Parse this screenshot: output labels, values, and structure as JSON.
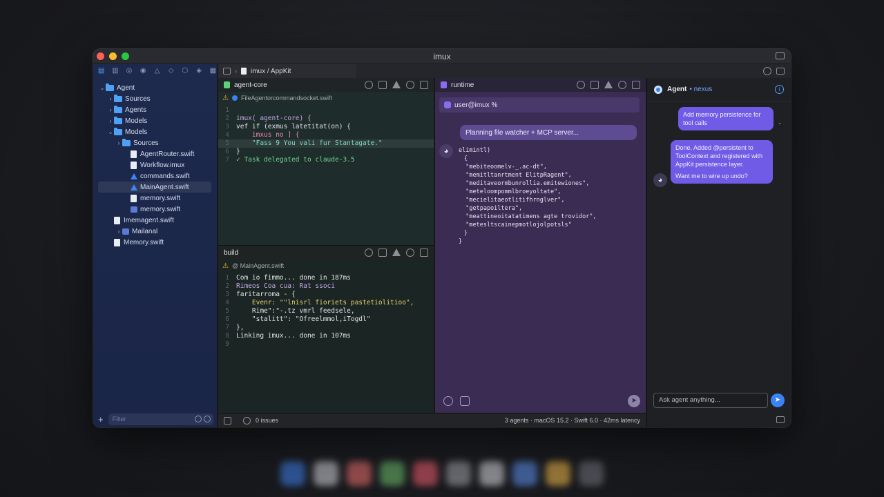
{
  "window": {
    "title": "imux"
  },
  "sidebar": {
    "toolbar_icons": [
      "navigator-icon",
      "source-control-icon",
      "symbol-icon",
      "find-icon",
      "issue-icon",
      "test-icon",
      "debug-icon",
      "breakpoint-icon",
      "report-icon"
    ],
    "tree": [
      {
        "label": "Agent",
        "type": "folder",
        "depth": 0,
        "expanded": true
      },
      {
        "label": "Sources",
        "type": "folder",
        "depth": 1,
        "expanded": false
      },
      {
        "label": "Agents",
        "type": "folder",
        "depth": 1,
        "expanded": false
      },
      {
        "label": "Models",
        "type": "folder",
        "depth": 1,
        "expanded": false
      },
      {
        "label": "Models",
        "type": "folder",
        "depth": 1,
        "expanded": true
      },
      {
        "label": "Sources",
        "type": "folder",
        "depth": 2,
        "expanded": false
      },
      {
        "label": "AgentRouter.swift",
        "type": "file",
        "depth": 3
      },
      {
        "label": "Workflow.imux",
        "type": "file",
        "depth": 3
      },
      {
        "label": "commands.swift",
        "type": "swift",
        "depth": 3
      },
      {
        "label": "MainAgent.swift",
        "type": "swift",
        "depth": 3,
        "selected": true
      },
      {
        "label": "memory.swift",
        "type": "file",
        "depth": 3
      },
      {
        "label": "memory.swift",
        "type": "bundle",
        "depth": 3
      },
      {
        "label": "Imemagent.swift",
        "type": "file",
        "depth": 1
      },
      {
        "label": "Mailanal",
        "type": "bundle",
        "depth": 2,
        "collapsed_chevron": true
      },
      {
        "label": "Memory.swift",
        "type": "file",
        "depth": 1
      }
    ],
    "filter_placeholder": "Filter"
  },
  "path_bar": {
    "crumb": "imux / AppKit"
  },
  "agent_core": {
    "title": "agent-core",
    "warning": "FileAgentorcommandsocket.swift",
    "lines": [
      {
        "n": "1",
        "text": "",
        "color": "#8a8e96"
      },
      {
        "n": "2",
        "text": "imux( agent-core) {",
        "color": "#c3a8e8"
      },
      {
        "n": "3",
        "text": "vef if (exmus latetitat(on) {",
        "color": "#e4e4e8"
      },
      {
        "n": "4",
        "text": "    imxus no ] {",
        "color": "#f08aa8"
      },
      {
        "n": "5",
        "text": "    \"Fass 9 You vali fur Stantagate.\"",
        "color": "#7ed8c0"
      },
      {
        "n": "6",
        "text": "}",
        "color": "#e4e4e8"
      },
      {
        "n": "7",
        "text": "✓ Task delegated to claude-3.5",
        "color": "#6fd88e"
      }
    ]
  },
  "build": {
    "title": "build",
    "warning": "@ MainAgent.swift",
    "lines": [
      {
        "n": "1",
        "text": "Com io fimmo... done in 187ms",
        "color": "#e4e4e8"
      },
      {
        "n": "2",
        "text": "Rimeos Coa cua: Rat ssoci",
        "color": "#c3a8e8"
      },
      {
        "n": "3",
        "text": "faritarroma - {",
        "color": "#e4e4e8"
      },
      {
        "n": "4",
        "text": "    Evenr: \"\"lnisrl fioriets pastetiolitioo\",",
        "color": "#e6d070"
      },
      {
        "n": "5",
        "text": "    Rime\":\"-.tz vmrl feedsele,",
        "color": "#e4e4e8"
      },
      {
        "n": "6",
        "text": "    \"stalitt\": \"Ofreelmmol,iTogdl\"",
        "color": "#e4e4e8"
      },
      {
        "n": "7",
        "text": "},",
        "color": "#e4e4e8"
      },
      {
        "n": "8",
        "text": "Linking imux... done in 107ms",
        "color": "#e4e4e8"
      },
      {
        "n": "9",
        "text": "",
        "color": "#8a8e96"
      }
    ]
  },
  "runtime": {
    "title": "runtime",
    "prompt": "user@imux %",
    "plan": "Planning file watcher + MCP server...",
    "output": [
      "elimintl)",
      "{",
      "  \"mebiteoomelv-_.ac-dt\",",
      "  \"memitltanrtment ElitpRagent\",",
      "  \"meditaveormbunrollia.emitewiones\",",
      "  \"meteloompommlbroeyoltate\",",
      "  \"mecielitaeotlitifhrnglver\",",
      "  \"getpapoiltera\",",
      "  \"meattineoitatatimens agte trovidor\",",
      "  \"metesltscainepmotlojolpotsls\"",
      "}",
      "}"
    ]
  },
  "status": {
    "issues": "0 issues",
    "summary": "3 agents · macOS 15.2 · Swift 6.0 · 42ms latency"
  },
  "agent": {
    "name": "Agent",
    "sub": "• nexus",
    "user_message": "Add memory persistence for tool calls",
    "reply_line1": "Done. Added @persistent to ToolContext and registered with AppKit persistence layer.",
    "reply_line2": "Want me to wire up undo?",
    "input_placeholder": "Ask agent anything..."
  },
  "colors": {
    "accent": "#3b82f6",
    "bubble": "#6f5be6",
    "sidebar": "#1d2a4d",
    "runtime": "#3a2c52"
  }
}
